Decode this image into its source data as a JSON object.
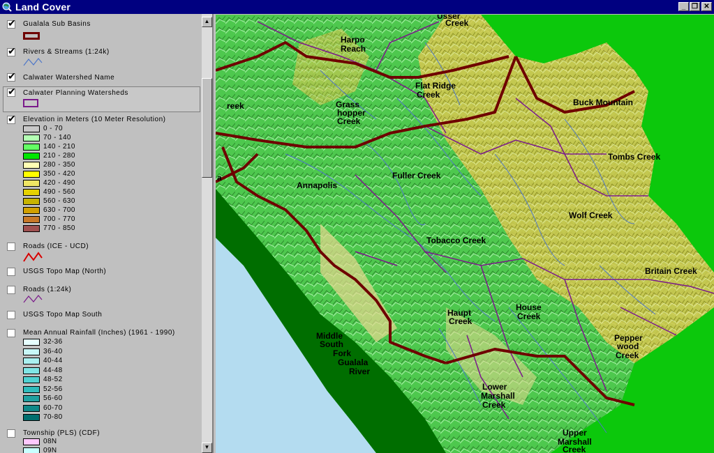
{
  "window": {
    "title": "Land Cover",
    "btn_min": "_",
    "btn_max": "❐",
    "btn_close": "✕"
  },
  "toc": {
    "layers": [
      {
        "name": "Gualala Sub Basins",
        "checked": true
      },
      {
        "name": "Rivers & Streams (1:24k)",
        "checked": true
      },
      {
        "name": "Calwater Watershed Name",
        "checked": true
      },
      {
        "name": "Calwater Planning Watersheds",
        "checked": true
      },
      {
        "name": "Elevation in Meters (10 Meter Resolution)",
        "checked": true
      },
      {
        "name": "Roads (ICE - UCD)",
        "checked": false
      },
      {
        "name": "USGS Topo Map (North)",
        "checked": false
      },
      {
        "name": "Roads (1:24k)",
        "checked": false
      },
      {
        "name": "USGS Topo Map South",
        "checked": false
      },
      {
        "name": "Mean Annual Rainfall (Inches) (1961 - 1990)",
        "checked": false
      },
      {
        "name": "Township (PLS) (CDF)",
        "checked": false
      }
    ],
    "elevation_legend": [
      {
        "label": "0 - 70",
        "color": "#c8c8c8"
      },
      {
        "label": "70 - 140",
        "color": "#b4ffb4"
      },
      {
        "label": "140 - 210",
        "color": "#64ff64"
      },
      {
        "label": "210 - 280",
        "color": "#00e600"
      },
      {
        "label": "280 - 350",
        "color": "#ffffb4"
      },
      {
        "label": "350 - 420",
        "color": "#ffff00"
      },
      {
        "label": "420 - 490",
        "color": "#f0e664"
      },
      {
        "label": "490 - 560",
        "color": "#e6d200"
      },
      {
        "label": "560 - 630",
        "color": "#c8b400"
      },
      {
        "label": "630 - 700",
        "color": "#d2a000"
      },
      {
        "label": "700 - 770",
        "color": "#c87828"
      },
      {
        "label": "770 - 850",
        "color": "#a05050"
      }
    ],
    "rainfall_legend": [
      {
        "label": "32-36",
        "color": "#e6ffff"
      },
      {
        "label": "36-40",
        "color": "#c8f8f8"
      },
      {
        "label": "40-44",
        "color": "#aaf0f0"
      },
      {
        "label": "44-48",
        "color": "#80e6e6"
      },
      {
        "label": "48-52",
        "color": "#50d2d2"
      },
      {
        "label": "52-56",
        "color": "#30bcbc"
      },
      {
        "label": "56-60",
        "color": "#20a0a0"
      },
      {
        "label": "60-70",
        "color": "#108888"
      },
      {
        "label": "70-80",
        "color": "#006e6e"
      }
    ],
    "township_legend": [
      {
        "label": "08N",
        "color": "#ffc8ff"
      },
      {
        "label": "09N",
        "color": "#c8ffff"
      }
    ]
  },
  "map": {
    "colors": {
      "ocean": "#b4dcf0",
      "coast": "#006e00",
      "outside": "#0cc80c",
      "basin": "#6e0000",
      "planning": "#7a1a8a",
      "stream": "#5078c8"
    },
    "labels": [
      {
        "text": "Usser",
        "id": "usser"
      },
      {
        "text": "Creek",
        "id": "usser2"
      },
      {
        "text": "Harpo",
        "id": "harpo"
      },
      {
        "text": "Reach",
        "id": "harpo2"
      },
      {
        "text": "reek",
        "id": "reek"
      },
      {
        "text": "Flat Ridge",
        "id": "flat"
      },
      {
        "text": "Creek",
        "id": "flat2"
      },
      {
        "text": "Buck Mountain",
        "id": "buck"
      },
      {
        "text": "Grass",
        "id": "grass"
      },
      {
        "text": "hopper",
        "id": "grass2"
      },
      {
        "text": "Creek",
        "id": "grass3"
      },
      {
        "text": "Tombs Creek",
        "id": "tombs"
      },
      {
        "text": "Fuller Creek",
        "id": "fuller"
      },
      {
        "text": "Annapolis",
        "id": "annapolis"
      },
      {
        "text": "a",
        "id": "a"
      },
      {
        "text": "Wolf Creek",
        "id": "wolf"
      },
      {
        "text": "Tobacco Creek",
        "id": "tobacco"
      },
      {
        "text": "Britain Creek",
        "id": "britain"
      },
      {
        "text": "House",
        "id": "house"
      },
      {
        "text": "Creek",
        "id": "house2"
      },
      {
        "text": "Haupt",
        "id": "haupt"
      },
      {
        "text": "Creek",
        "id": "haupt2"
      },
      {
        "text": "Middle",
        "id": "middle"
      },
      {
        "text": "South",
        "id": "middle2"
      },
      {
        "text": "Fork",
        "id": "middle3"
      },
      {
        "text": "Gualala",
        "id": "middle4"
      },
      {
        "text": "River",
        "id": "middle5"
      },
      {
        "text": "Pepper",
        "id": "pepper"
      },
      {
        "text": "wood",
        "id": "pepper2"
      },
      {
        "text": "Creek",
        "id": "pepper3"
      },
      {
        "text": "Lower",
        "id": "lower"
      },
      {
        "text": "Marshall",
        "id": "lower2"
      },
      {
        "text": "Creek",
        "id": "lower3"
      },
      {
        "text": "Upper",
        "id": "upper"
      },
      {
        "text": "Marshall",
        "id": "upper2"
      },
      {
        "text": "Creek",
        "id": "upper3"
      }
    ]
  }
}
